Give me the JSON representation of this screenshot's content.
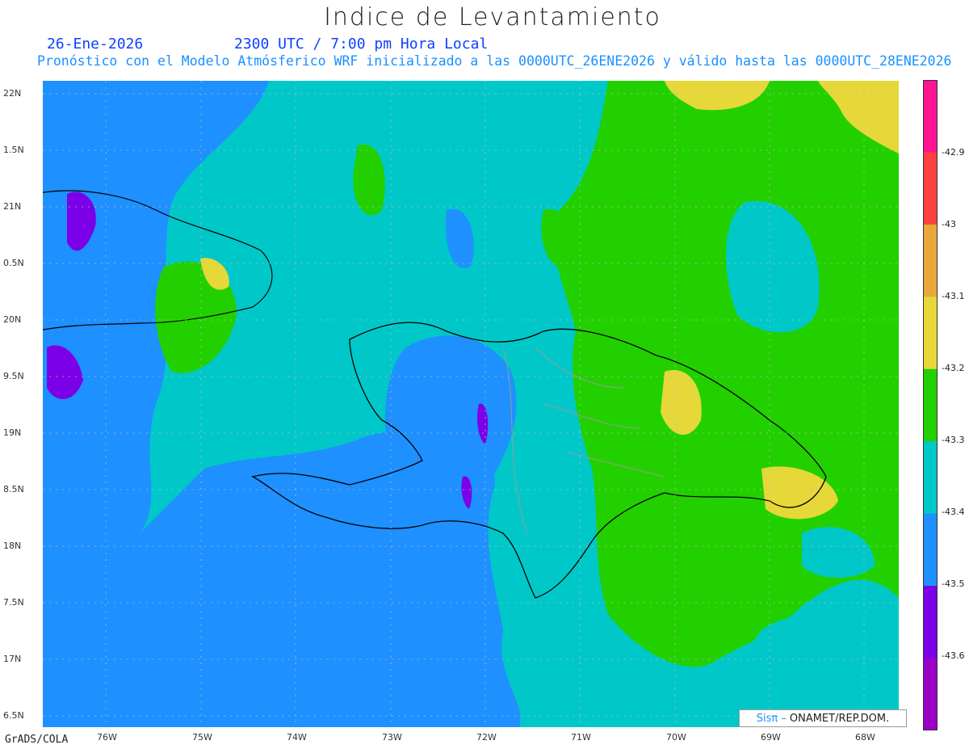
{
  "title": "Indice de Levantamiento",
  "date": "26-Ene-2026",
  "time": "2300 UTC / 7:00 pm Hora Local",
  "model_line": "Pronóstico con el Modelo Atmósferico WRF inicializado a las 0000UTC_26ENE2026 y válido hasta las  0000UTC_28ENE2026",
  "lat_labels": [
    "22N",
    "1.5N",
    "21N",
    "0.5N",
    "20N",
    "9.5N",
    "19N",
    "8.5N",
    "18N",
    "7.5N",
    "17N",
    "6.5N"
  ],
  "lon_labels": [
    "76W",
    "75W",
    "74W",
    "73W",
    "72W",
    "71W",
    "70W",
    "69W",
    "68W"
  ],
  "colorbar": {
    "labels": [
      "-42.9",
      "-43",
      "-43.1",
      "-43.2",
      "-43.3",
      "-43.4",
      "-43.5",
      "-43.6"
    ],
    "colors": [
      "#ff1493",
      "#ff4040",
      "#e8a83a",
      "#e6d838",
      "#22d000",
      "#00c8c8",
      "#1e90ff",
      "#7b00e8",
      "#9b00c8"
    ]
  },
  "credit": "GrADS/COLA",
  "brand": {
    "sis": "Sisπ –",
    "org": "ONAMET/REP.DOM."
  }
}
